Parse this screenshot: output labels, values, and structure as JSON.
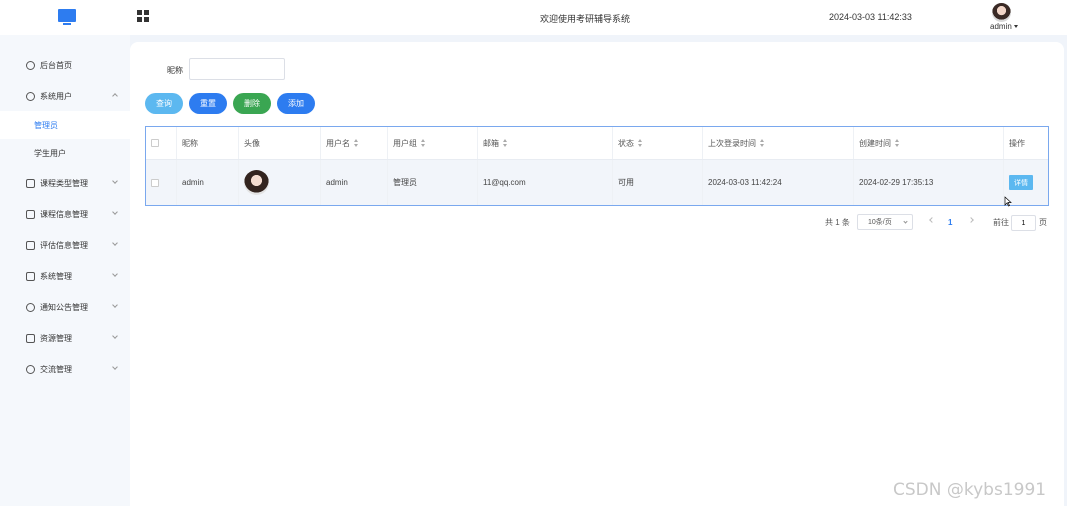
{
  "header": {
    "welcome": "欢迎使用考研辅导系统",
    "datetime": "2024-03-03 11:42:33",
    "user": "admin"
  },
  "sidebar": {
    "items": [
      {
        "label": "后台首页",
        "icon": "clock-icon"
      },
      {
        "label": "系统用户",
        "icon": "user-icon",
        "expanded": true
      },
      {
        "label": "管理员",
        "sub": true,
        "active": true
      },
      {
        "label": "学生用户",
        "sub": true
      },
      {
        "label": "课程类型管理",
        "icon": "doc-icon"
      },
      {
        "label": "课程信息管理",
        "icon": "doc-icon"
      },
      {
        "label": "评估信息管理",
        "icon": "doc-icon"
      },
      {
        "label": "系统管理",
        "icon": "folder-icon"
      },
      {
        "label": "通知公告管理",
        "icon": "sun-icon"
      },
      {
        "label": "资源管理",
        "icon": "box-icon"
      },
      {
        "label": "交流管理",
        "icon": "headset-icon"
      }
    ]
  },
  "search": {
    "label": "昵称",
    "value": ""
  },
  "buttons": {
    "query": "查询",
    "reset": "重置",
    "delete": "删除",
    "add": "添加"
  },
  "table": {
    "columns": [
      "昵称",
      "头像",
      "用户名",
      "用户组",
      "邮箱",
      "状态",
      "上次登录时间",
      "创建时间",
      "操作"
    ],
    "rows": [
      {
        "nickname": "admin",
        "username": "admin",
        "group": "管理员",
        "email": "11@qq.com",
        "status": "可用",
        "last_login": "2024-03-03 11:42:24",
        "created": "2024-02-29 17:35:13",
        "action": "详情"
      }
    ]
  },
  "pager": {
    "total": "共 1 条",
    "page_size": "10条/页",
    "current_page": "1",
    "goto_label": "前往",
    "goto_value": "1",
    "page_suffix": "页"
  },
  "watermark": "CSDN @kybs1991",
  "colors": {
    "primary": "#2d7cf0",
    "info": "#5cb8f0",
    "success": "#3aa652"
  }
}
